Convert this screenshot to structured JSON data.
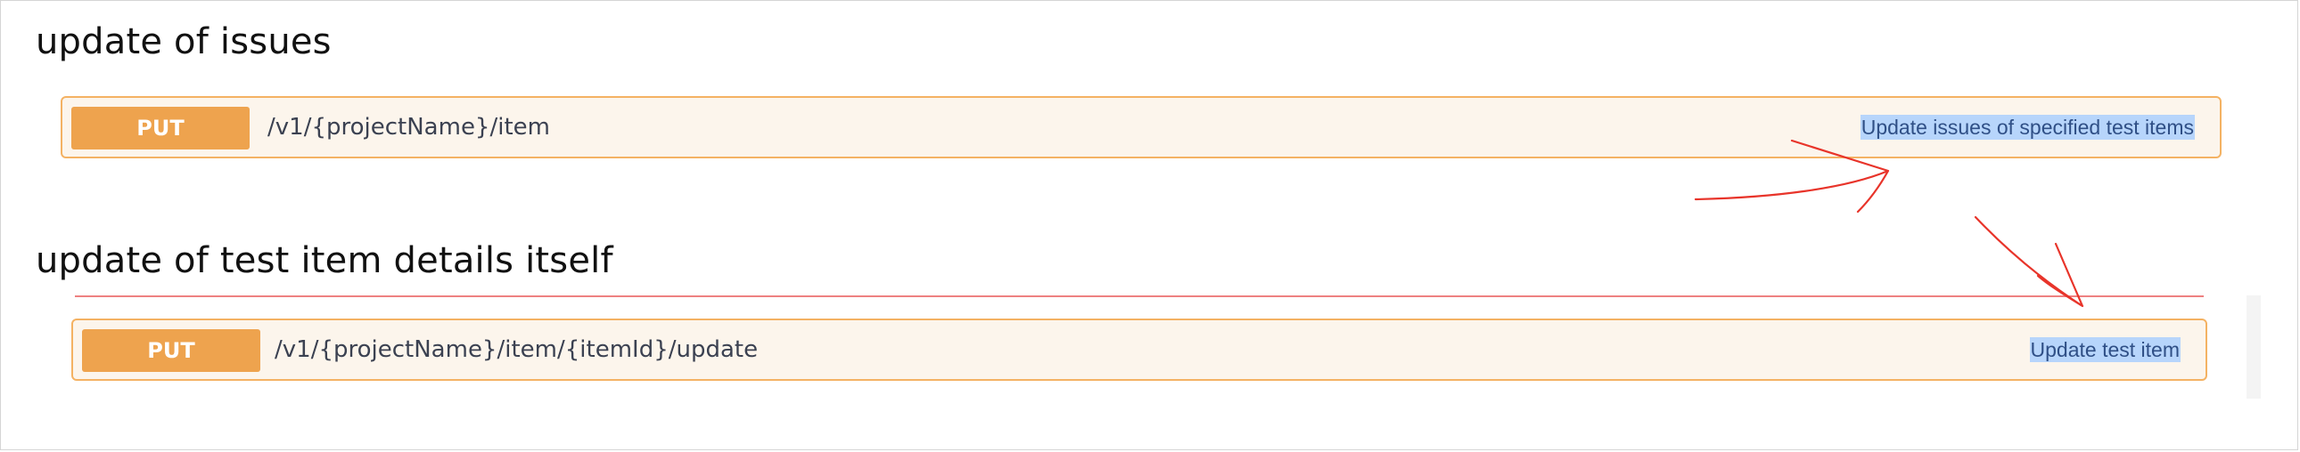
{
  "sections": [
    {
      "title": "update of issues",
      "operation": {
        "method": "PUT",
        "path": "/v1/{projectName}/item",
        "summary": "Update issues of specified test items"
      }
    },
    {
      "title": "update of test item details itself",
      "operation": {
        "method": "PUT",
        "path": "/v1/{projectName}/item/{itemId}/update",
        "summary": "Update test item"
      }
    }
  ],
  "colors": {
    "put_badge": "#eea34e",
    "block_background": "#fcf5ec",
    "block_border": "#f4b263",
    "text_selection": "#b7d5fb",
    "annotation_red": "#e8342a"
  }
}
